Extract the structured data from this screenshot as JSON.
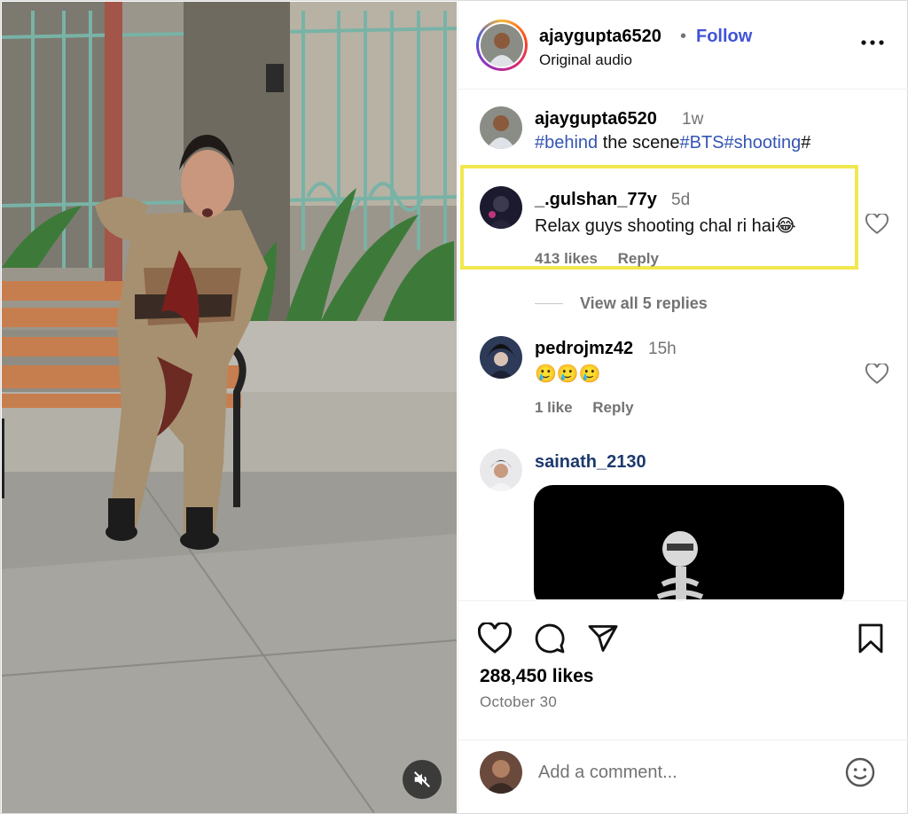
{
  "post": {
    "username": "ajaygupta6520",
    "separator": "•",
    "follow_label": "Follow",
    "audio": "Original audio"
  },
  "caption": {
    "username": "ajaygupta6520",
    "time": "1w",
    "segments": [
      "#behind",
      " the scene",
      "#BTS#shooting",
      "#"
    ]
  },
  "comments": [
    {
      "username": "_.gulshan_77y",
      "time": "5d",
      "text": "Relax guys shooting chal ri hai😂",
      "likes": "413 likes",
      "reply": "Reply",
      "highlighted": true
    },
    {
      "username": "pedrojmz42",
      "time": "15h",
      "text": "🥲🥲🥲",
      "likes": "1 like",
      "reply": "Reply",
      "highlighted": false
    },
    {
      "username": "sainath_2130",
      "time": "",
      "text": "",
      "likes": "",
      "reply": "",
      "highlighted": false
    }
  ],
  "view_replies": "View all 5 replies",
  "stats": {
    "likes": "288,450 likes",
    "date": "October 30"
  },
  "add_comment": {
    "placeholder": "Add a comment..."
  },
  "icons": [
    "heart-icon",
    "comment-icon",
    "share-icon",
    "bookmark-icon",
    "more-icon",
    "mute-icon",
    "emoji-icon"
  ],
  "colors": {
    "follow": "#4154d6",
    "hashtag": "#3455b3",
    "highlight_box": "#f1e84f",
    "muted_text": "#737373"
  }
}
